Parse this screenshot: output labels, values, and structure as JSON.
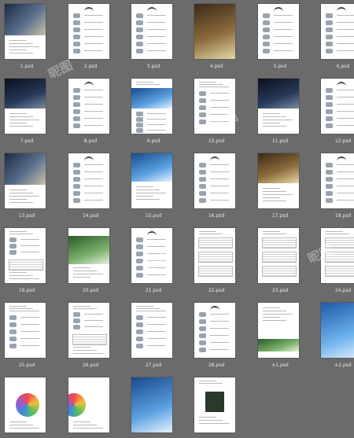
{
  "thumbnails": [
    {
      "caption": "1.psd",
      "style": "photo-top"
    },
    {
      "caption": "2.psd",
      "style": "catalog"
    },
    {
      "caption": "3.psd",
      "style": "catalog"
    },
    {
      "caption": "4.psd",
      "style": "photo-full"
    },
    {
      "caption": "5.psd",
      "style": "catalog"
    },
    {
      "caption": "6.psd",
      "style": "catalog"
    },
    {
      "caption": "7.psd",
      "style": "photo-top-dark"
    },
    {
      "caption": "8.psd",
      "style": "catalog"
    },
    {
      "caption": "9.psd",
      "style": "photo-mid"
    },
    {
      "caption": "10.psd",
      "style": "catalog-product"
    },
    {
      "caption": "11.psd",
      "style": "photo-top-dark"
    },
    {
      "caption": "12.psd",
      "style": "catalog"
    },
    {
      "caption": "13.psd",
      "style": "photo-top"
    },
    {
      "caption": "14.psd",
      "style": "catalog"
    },
    {
      "caption": "15.psd",
      "style": "photo-mid-blue"
    },
    {
      "caption": "16.psd",
      "style": "catalog"
    },
    {
      "caption": "17.psd",
      "style": "photo-top-warm"
    },
    {
      "caption": "18.psd",
      "style": "catalog"
    },
    {
      "caption": "19.psd",
      "style": "catalog-table"
    },
    {
      "caption": "20.psd",
      "style": "photo-green"
    },
    {
      "caption": "21.psd",
      "style": "catalog"
    },
    {
      "caption": "22.psd",
      "style": "table"
    },
    {
      "caption": "23.psd",
      "style": "table"
    },
    {
      "caption": "24.psd",
      "style": "table"
    },
    {
      "caption": "25.psd",
      "style": "catalog-product"
    },
    {
      "caption": "26.psd",
      "style": "catalog-table"
    },
    {
      "caption": "27.psd",
      "style": "catalog-product"
    },
    {
      "caption": "28.psd",
      "style": "catalog"
    },
    {
      "caption": "±1.psd",
      "style": "catalog-green"
    },
    {
      "caption": "±2.psd",
      "style": "photo-full-blue"
    },
    {
      "caption": "",
      "style": "flower"
    },
    {
      "caption": "",
      "style": "flower-half"
    },
    {
      "caption": "",
      "style": "photo-full-building"
    },
    {
      "caption": "",
      "style": "dark-center"
    }
  ],
  "watermark_text": "昵图"
}
